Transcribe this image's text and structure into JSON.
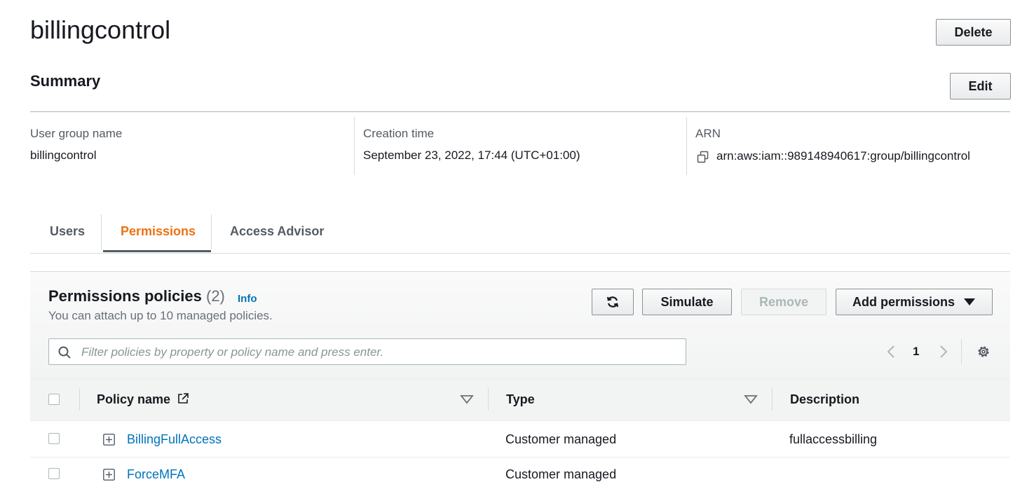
{
  "header": {
    "title": "billingcontrol",
    "delete_label": "Delete"
  },
  "summary": {
    "title": "Summary",
    "edit_label": "Edit",
    "fields": [
      {
        "label": "User group name",
        "value": "billingcontrol"
      },
      {
        "label": "Creation time",
        "value": "September 23, 2022, 17:44 (UTC+01:00)"
      },
      {
        "label": "ARN",
        "value": "arn:aws:iam::989148940617:group/billingcontrol"
      }
    ]
  },
  "tabs": [
    {
      "label": "Users",
      "active": false
    },
    {
      "label": "Permissions",
      "active": true
    },
    {
      "label": "Access Advisor",
      "active": false
    }
  ],
  "permissions": {
    "title": "Permissions policies",
    "count": "(2)",
    "info_label": "Info",
    "description": "You can attach up to 10 managed policies.",
    "simulate_label": "Simulate",
    "remove_label": "Remove",
    "add_permissions_label": "Add permissions",
    "search_placeholder": "Filter policies by property or policy name and press enter.",
    "page_number": "1",
    "columns": {
      "policy_name": "Policy name",
      "type": "Type",
      "description": "Description"
    },
    "rows": [
      {
        "name": "BillingFullAccess",
        "type": "Customer managed",
        "description": "fullaccessbilling"
      },
      {
        "name": "ForceMFA",
        "type": "Customer managed",
        "description": ""
      }
    ]
  },
  "colors": {
    "accent": "#ec7211",
    "link": "#0073bb",
    "text": "#16191f",
    "muted": "#545b64"
  },
  "icons": {
    "copy": "copy-icon",
    "refresh": "refresh-icon",
    "search": "search-icon",
    "settings": "gear-icon",
    "external": "external-link-icon",
    "expand": "expand-plus-icon"
  }
}
